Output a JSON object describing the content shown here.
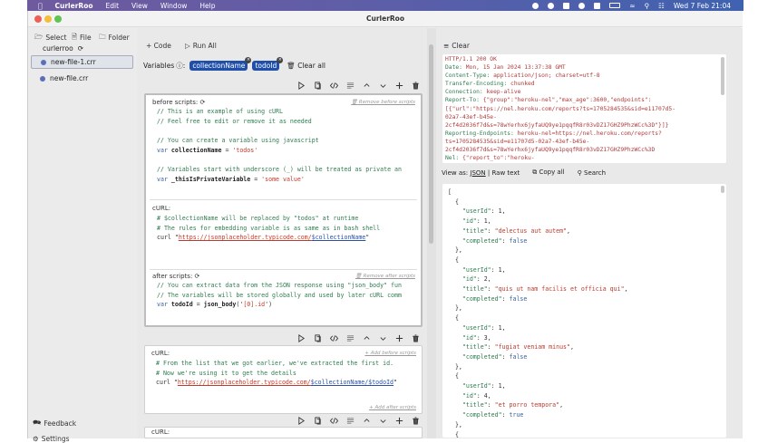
{
  "menubar": {
    "app": "CurlerRoo",
    "items": [
      "Edit",
      "View",
      "Window",
      "Help"
    ],
    "clock": "Wed 7 Feb  21:04"
  },
  "window": {
    "title": "CurlerRoo"
  },
  "sidebar": {
    "toolbar": {
      "select": "Select",
      "file": "File",
      "folder": "Folder"
    },
    "root": "curlerroo",
    "files": [
      {
        "name": "new-file-1.crr",
        "selected": true
      },
      {
        "name": "new-file.crr",
        "selected": false
      }
    ],
    "feedback": "Feedback",
    "settings": "Settings"
  },
  "editor": {
    "toolbar": {
      "code": "+ Code",
      "run_all": "Run All"
    },
    "variables": {
      "label": "Variables",
      "chips": [
        "collectionName",
        "todoId"
      ],
      "clear_all": "Clear all"
    },
    "blocks": [
      {
        "before_label": "before scripts:",
        "before_link": "Remove before scripts",
        "before_code": [
          [
            [
              "// This is an example of using cURL",
              "com"
            ]
          ],
          [
            [
              "// Feel free to edit or remove it as needed",
              "com"
            ]
          ],
          [],
          [
            [
              "// You can create a variable using javascript",
              "com"
            ]
          ],
          [
            [
              "var ",
              "kw"
            ],
            [
              "collectionName",
              "id"
            ],
            [
              " = ",
              "plain"
            ],
            [
              "'todos'",
              "str"
            ]
          ],
          [],
          [
            [
              "// Variables start with underscore (_) will be treated as private an",
              "com"
            ]
          ],
          [
            [
              "var ",
              "kw"
            ],
            [
              "_thisIsPrivateVariable",
              "id"
            ],
            [
              " = ",
              "plain"
            ],
            [
              "'some value'",
              "str"
            ]
          ]
        ],
        "curl_label": "cURL:",
        "curl_code": [
          [
            [
              "# $collectionName will be replaced by \"todos\" at runtime",
              "com"
            ]
          ],
          [
            [
              "# The rules for embedding variable is as same as in bash shell",
              "com"
            ]
          ],
          [
            [
              "curl \"",
              "plain"
            ],
            [
              "https://jsonplaceholder.typicode.com/",
              "url"
            ],
            [
              "$collectionName",
              "var"
            ],
            [
              "\"",
              "plain"
            ]
          ]
        ],
        "after_label": "after scripts:",
        "after_link": "Remove after scripts",
        "after_code": [
          [
            [
              "// You can extract data from the JSON response using \"json_body\" fun",
              "com"
            ]
          ],
          [
            [
              "// The variables will be stored globally and used by later cURL comm",
              "com"
            ]
          ],
          [
            [
              "var ",
              "kw"
            ],
            [
              "todoId",
              "id"
            ],
            [
              " = ",
              "plain"
            ],
            [
              "json_body",
              "id"
            ],
            [
              "('",
              "plain"
            ],
            [
              "[0].id",
              "str"
            ],
            [
              "')",
              "plain"
            ]
          ]
        ]
      },
      {
        "curl_label": "cURL:",
        "before_link": "+ Add before scripts",
        "after_link": "+ Add after scripts",
        "curl_code": [
          [
            [
              "# From the list that we got earlier, we've extracted the first id.",
              "com"
            ]
          ],
          [
            [
              "# Now we're using it to get the details",
              "com"
            ]
          ],
          [
            [
              "curl \"",
              "plain"
            ],
            [
              "https://jsonplaceholder.typicode.com/",
              "url"
            ],
            [
              "$collectionName/$todoId",
              "var"
            ],
            [
              "\"",
              "plain"
            ]
          ]
        ]
      },
      {
        "curl_label": "cURL:"
      }
    ]
  },
  "response": {
    "clear": "Clear",
    "headers": [
      [
        [
          "HTTP/1.1 200 OK",
          "hval"
        ]
      ],
      [
        [
          "Date: ",
          "hname"
        ],
        [
          "Mon, 15 Jan 2024 13:37:38 GMT",
          "hval"
        ]
      ],
      [
        [
          "Content-Type: ",
          "hname"
        ],
        [
          "application/json; charset=utf-8",
          "hval"
        ]
      ],
      [
        [
          "Transfer-Encoding: ",
          "hname"
        ],
        [
          "chunked",
          "hval"
        ]
      ],
      [
        [
          "Connection: ",
          "hname"
        ],
        [
          "keep-alive",
          "hval"
        ]
      ],
      [
        [
          "Report-To: ",
          "hname"
        ],
        [
          "{\"group\":\"heroku-nel\",\"max_age\":3600,\"endpoints\":",
          "hval"
        ]
      ],
      [
        [
          "[{\"url\":\"https://nel.heroku.com/reports?ts=1705284535&sid=e11707d5-",
          "hval"
        ]
      ],
      [
        [
          "02a7-43ef-b45e-",
          "hval"
        ]
      ],
      [
        [
          "2cf4d2036f7d&s=78wYerhx6jyfaUQ9ye1pqqfR8r03vDZ17GHZ9PhzWCc%3D\"}]}",
          "hval"
        ]
      ],
      [
        [
          "Reporting-Endpoints: ",
          "hname"
        ],
        [
          "heroku-nel=https://nel.heroku.com/reports?",
          "hval"
        ]
      ],
      [
        [
          "ts=1705284535&sid=e11707d5-02a7-43ef-b45e-",
          "hval"
        ]
      ],
      [
        [
          "2cf4d2036f7d&s=78wYerhx6jyfaUQ9ye1pqqfR8r03vDZ17GHZ9PhzWCc%3D",
          "hval"
        ]
      ],
      [
        [
          "Nel: ",
          "hname"
        ],
        [
          "{\"report_to\":\"heroku-",
          "hval"
        ]
      ]
    ],
    "view_as_label": "View as:",
    "view_json": "JSON",
    "view_raw": "Raw text",
    "copy_all": "Copy all",
    "search": "Search",
    "body": [
      [
        [
          "[",
          "plain"
        ]
      ],
      [
        [
          "  {",
          "plain"
        ]
      ],
      [
        [
          "    \"userId\"",
          "key"
        ],
        [
          ": 1,",
          "plain"
        ]
      ],
      [
        [
          "    \"id\"",
          "key"
        ],
        [
          ": 1,",
          "plain"
        ]
      ],
      [
        [
          "    \"title\"",
          "key"
        ],
        [
          ": ",
          "plain"
        ],
        [
          "\"delectus aut autem\"",
          "str"
        ],
        [
          ",",
          "plain"
        ]
      ],
      [
        [
          "    \"completed\"",
          "key"
        ],
        [
          ": ",
          "plain"
        ],
        [
          "false",
          "bool"
        ]
      ],
      [
        [
          "  },",
          "plain"
        ]
      ],
      [
        [
          "  {",
          "plain"
        ]
      ],
      [
        [
          "    \"userId\"",
          "key"
        ],
        [
          ": 1,",
          "plain"
        ]
      ],
      [
        [
          "    \"id\"",
          "key"
        ],
        [
          ": 2,",
          "plain"
        ]
      ],
      [
        [
          "    \"title\"",
          "key"
        ],
        [
          ": ",
          "plain"
        ],
        [
          "\"quis ut nam facilis et officia qui\"",
          "str"
        ],
        [
          ",",
          "plain"
        ]
      ],
      [
        [
          "    \"completed\"",
          "key"
        ],
        [
          ": ",
          "plain"
        ],
        [
          "false",
          "bool"
        ]
      ],
      [
        [
          "  },",
          "plain"
        ]
      ],
      [
        [
          "  {",
          "plain"
        ]
      ],
      [
        [
          "    \"userId\"",
          "key"
        ],
        [
          ": 1,",
          "plain"
        ]
      ],
      [
        [
          "    \"id\"",
          "key"
        ],
        [
          ": 3,",
          "plain"
        ]
      ],
      [
        [
          "    \"title\"",
          "key"
        ],
        [
          ": ",
          "plain"
        ],
        [
          "\"fugiat veniam minus\"",
          "str"
        ],
        [
          ",",
          "plain"
        ]
      ],
      [
        [
          "    \"completed\"",
          "key"
        ],
        [
          ": ",
          "plain"
        ],
        [
          "false",
          "bool"
        ]
      ],
      [
        [
          "  },",
          "plain"
        ]
      ],
      [
        [
          "  {",
          "plain"
        ]
      ],
      [
        [
          "    \"userId\"",
          "key"
        ],
        [
          ": 1,",
          "plain"
        ]
      ],
      [
        [
          "    \"id\"",
          "key"
        ],
        [
          ": 4,",
          "plain"
        ]
      ],
      [
        [
          "    \"title\"",
          "key"
        ],
        [
          ": ",
          "plain"
        ],
        [
          "\"et porro tempora\"",
          "str"
        ],
        [
          ",",
          "plain"
        ]
      ],
      [
        [
          "    \"completed\"",
          "key"
        ],
        [
          ": ",
          "plain"
        ],
        [
          "true",
          "bool"
        ]
      ],
      [
        [
          "  },",
          "plain"
        ]
      ],
      [
        [
          "  {",
          "plain"
        ]
      ]
    ]
  },
  "colors": {
    "accent": "#1f4fa8",
    "chip": "#1f4fa8",
    "comment": "#2e7d4f",
    "string": "#c0392b"
  }
}
